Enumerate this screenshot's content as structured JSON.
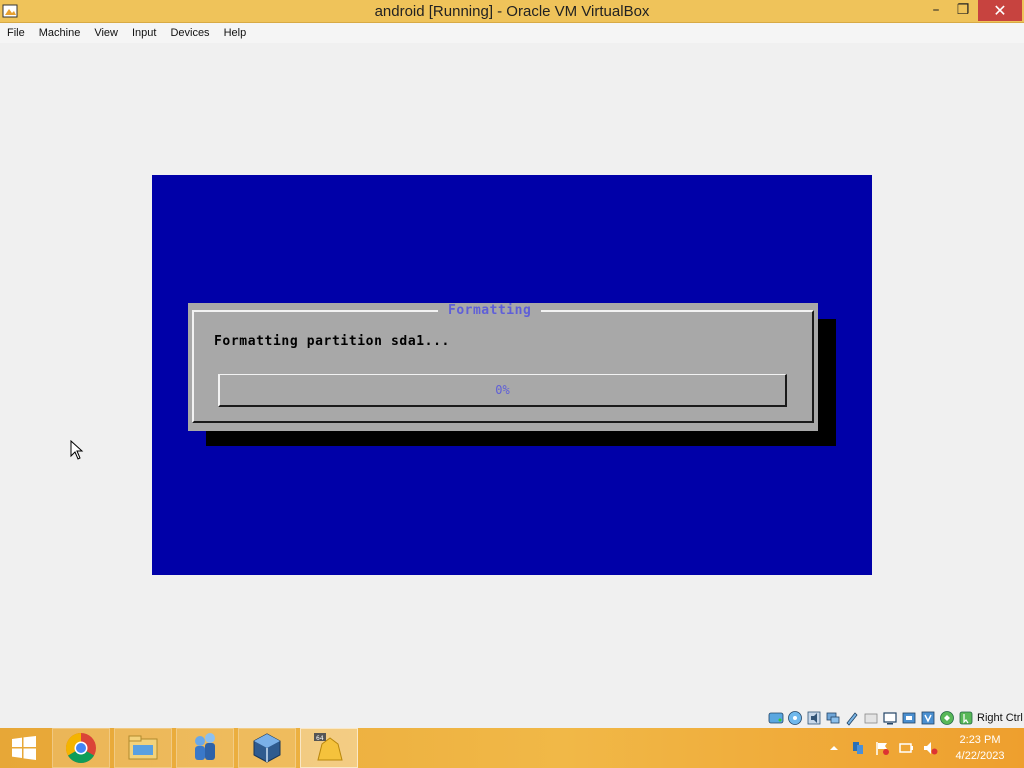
{
  "window": {
    "title": "android [Running] - Oracle VM VirtualBox",
    "minimize_glyph": "–",
    "restore_glyph": "❐",
    "close_glyph": "✕"
  },
  "menu": {
    "items": [
      {
        "label": "File"
      },
      {
        "label": "Machine"
      },
      {
        "label": "View"
      },
      {
        "label": "Input"
      },
      {
        "label": "Devices"
      },
      {
        "label": "Help"
      }
    ]
  },
  "vm": {
    "dialog": {
      "title": "Formatting",
      "message": "Formatting partition sda1...",
      "progress_text": "0%",
      "progress_fraction": 0
    }
  },
  "statusbar": {
    "icons": [
      "harddisk-icon",
      "optical-drive-icon",
      "audio-icon",
      "network-icon",
      "usb-icon",
      "shared-folders-icon",
      "display-icon",
      "video-capture-icon",
      "virtualization-icon",
      "cpu-icon",
      "mouse-integration-icon",
      "keyboard-capture-icon"
    ],
    "host_key": "Right Ctrl"
  },
  "taskbar": {
    "apps": [
      "chrome-icon",
      "file-explorer-icon",
      "network-users-icon",
      "virtualbox-icon",
      "vm-window-icon"
    ],
    "tray_icons": [
      "show-hidden-icons-icon",
      "network-status-icon",
      "action-center-flag-icon",
      "power-icon",
      "volume-muted-icon"
    ],
    "time": "2:23 PM",
    "date": "4/22/2023"
  },
  "colors": {
    "titlebar": "#efc35a",
    "vm_background": "#0000a8",
    "dialog_gray": "#a8a8a8",
    "dialog_title": "#5f5fd8",
    "taskbar": "#f1b847"
  }
}
